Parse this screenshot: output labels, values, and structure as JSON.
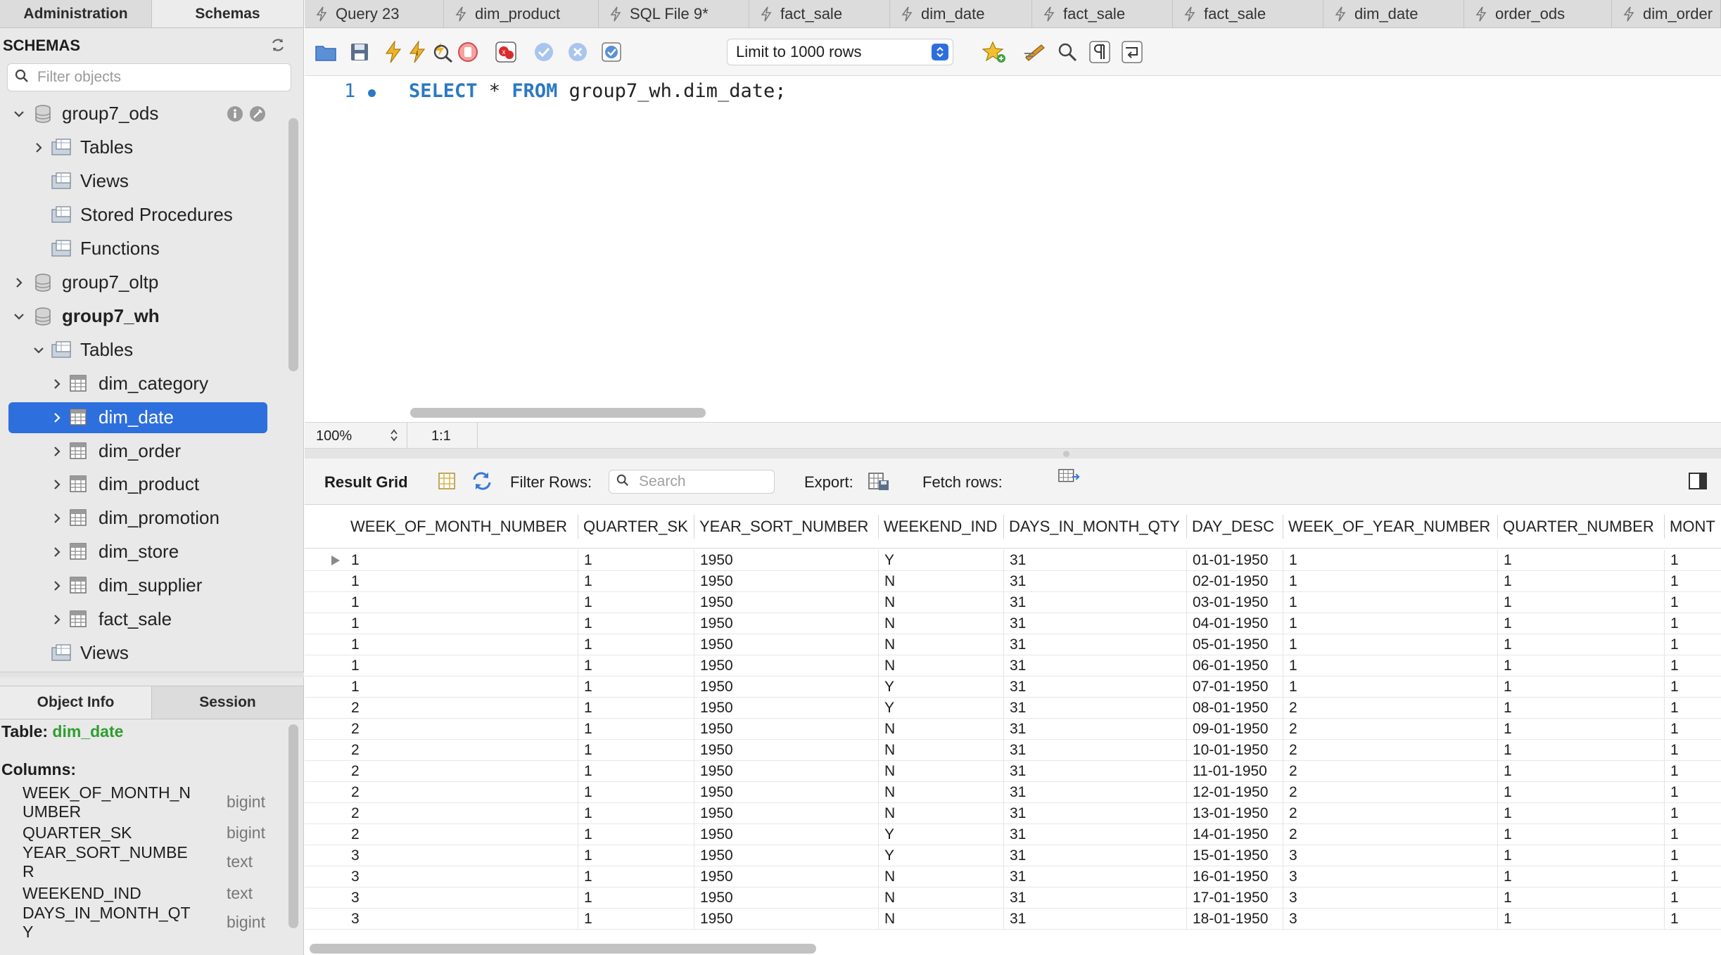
{
  "sidebar": {
    "tabs": [
      "Administration",
      "Schemas"
    ],
    "schemas_title": "SCHEMAS",
    "filter_placeholder": "Filter objects",
    "tree": [
      {
        "label": "group7_ods",
        "level": 0,
        "expanded": true,
        "icon": "database-icon"
      },
      {
        "label": "Tables",
        "level": 1,
        "expanded": false,
        "icon": "folder-icon"
      },
      {
        "label": "Views",
        "level": 1,
        "icon": "folder-icon"
      },
      {
        "label": "Stored Procedures",
        "level": 1,
        "icon": "folder-icon"
      },
      {
        "label": "Functions",
        "level": 1,
        "icon": "folder-icon"
      },
      {
        "label": "group7_oltp",
        "level": 0,
        "expanded": false,
        "icon": "database-icon"
      },
      {
        "label": "group7_wh",
        "level": 0,
        "expanded": true,
        "icon": "database-icon",
        "bold": true
      },
      {
        "label": "Tables",
        "level": 1,
        "expanded": true,
        "icon": "folder-icon"
      },
      {
        "label": "dim_category",
        "level": 2,
        "icon": "table-icon"
      },
      {
        "label": "dim_date",
        "level": 2,
        "icon": "table-icon",
        "selected": true
      },
      {
        "label": "dim_order",
        "level": 2,
        "icon": "table-icon"
      },
      {
        "label": "dim_product",
        "level": 2,
        "icon": "table-icon"
      },
      {
        "label": "dim_promotion",
        "level": 2,
        "icon": "table-icon"
      },
      {
        "label": "dim_store",
        "level": 2,
        "icon": "table-icon"
      },
      {
        "label": "dim_supplier",
        "level": 2,
        "icon": "table-icon"
      },
      {
        "label": "fact_sale",
        "level": 2,
        "icon": "table-icon"
      },
      {
        "label": "Views",
        "level": 1,
        "icon": "folder-icon"
      }
    ],
    "bottom_tabs": [
      "Object Info",
      "Session"
    ],
    "object_info": {
      "table_prefix": "Table:",
      "table_name": "dim_date",
      "columns_label": "Columns:",
      "columns": [
        {
          "name": "WEEK_OF_MONTH_N\nUMBER",
          "type": "bigint"
        },
        {
          "name": "QUARTER_SK",
          "type": "bigint"
        },
        {
          "name": "YEAR_SORT_NUMBE\nR",
          "type": "text"
        },
        {
          "name": "WEEKEND_IND",
          "type": "text"
        },
        {
          "name": "DAYS_IN_MONTH_QT\nY",
          "type": "bigint"
        }
      ]
    }
  },
  "tabs": [
    {
      "label": "Query 23"
    },
    {
      "label": "dim_product"
    },
    {
      "label": "SQL File 9*"
    },
    {
      "label": "fact_sale"
    },
    {
      "label": "dim_date"
    },
    {
      "label": "fact_sale"
    },
    {
      "label": "fact_sale"
    },
    {
      "label": "dim_date"
    },
    {
      "label": "order_ods"
    },
    {
      "label": "dim_order"
    }
  ],
  "toolbar": {
    "limit_label": "Limit to 1000 rows"
  },
  "editor": {
    "line_number": "1",
    "sql_keyword1": "SELECT",
    "sql_star": " * ",
    "sql_keyword2": "FROM",
    "sql_rest": " group7_wh.dim_date;"
  },
  "status": {
    "zoom": "100%",
    "cursor": "1:1"
  },
  "result_toolbar": {
    "result_grid": "Result Grid",
    "filter_rows": "Filter Rows:",
    "search_placeholder": "Search",
    "export": "Export:",
    "fetch_rows": "Fetch rows:"
  },
  "grid": {
    "columns": [
      "WEEK_OF_MONTH_NUMBER",
      "QUARTER_SK",
      "YEAR_SORT_NUMBER",
      "WEEKEND_IND",
      "DAYS_IN_MONTH_QTY",
      "DAY_DESC",
      "WEEK_OF_YEAR_NUMBER",
      "QUARTER_NUMBER",
      "MONT"
    ],
    "rows": [
      [
        "1",
        "1",
        "1950",
        "Y",
        "31",
        "01-01-1950",
        "1",
        "1",
        "1"
      ],
      [
        "1",
        "1",
        "1950",
        "N",
        "31",
        "02-01-1950",
        "1",
        "1",
        "1"
      ],
      [
        "1",
        "1",
        "1950",
        "N",
        "31",
        "03-01-1950",
        "1",
        "1",
        "1"
      ],
      [
        "1",
        "1",
        "1950",
        "N",
        "31",
        "04-01-1950",
        "1",
        "1",
        "1"
      ],
      [
        "1",
        "1",
        "1950",
        "N",
        "31",
        "05-01-1950",
        "1",
        "1",
        "1"
      ],
      [
        "1",
        "1",
        "1950",
        "N",
        "31",
        "06-01-1950",
        "1",
        "1",
        "1"
      ],
      [
        "1",
        "1",
        "1950",
        "Y",
        "31",
        "07-01-1950",
        "1",
        "1",
        "1"
      ],
      [
        "2",
        "1",
        "1950",
        "Y",
        "31",
        "08-01-1950",
        "2",
        "1",
        "1"
      ],
      [
        "2",
        "1",
        "1950",
        "N",
        "31",
        "09-01-1950",
        "2",
        "1",
        "1"
      ],
      [
        "2",
        "1",
        "1950",
        "N",
        "31",
        "10-01-1950",
        "2",
        "1",
        "1"
      ],
      [
        "2",
        "1",
        "1950",
        "N",
        "31",
        "11-01-1950",
        "2",
        "1",
        "1"
      ],
      [
        "2",
        "1",
        "1950",
        "N",
        "31",
        "12-01-1950",
        "2",
        "1",
        "1"
      ],
      [
        "2",
        "1",
        "1950",
        "N",
        "31",
        "13-01-1950",
        "2",
        "1",
        "1"
      ],
      [
        "2",
        "1",
        "1950",
        "Y",
        "31",
        "14-01-1950",
        "2",
        "1",
        "1"
      ],
      [
        "3",
        "1",
        "1950",
        "Y",
        "31",
        "15-01-1950",
        "3",
        "1",
        "1"
      ],
      [
        "3",
        "1",
        "1950",
        "N",
        "31",
        "16-01-1950",
        "3",
        "1",
        "1"
      ],
      [
        "3",
        "1",
        "1950",
        "N",
        "31",
        "17-01-1950",
        "3",
        "1",
        "1"
      ],
      [
        "3",
        "1",
        "1950",
        "N",
        "31",
        "18-01-1950",
        "3",
        "1",
        "1"
      ]
    ]
  },
  "colors": {
    "accent": "#2e6fde",
    "keyword": "#2b79c2",
    "table_name": "#2f9e2f"
  }
}
